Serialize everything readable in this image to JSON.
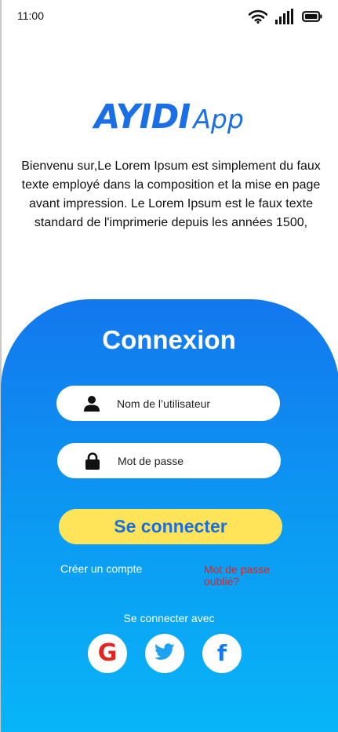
{
  "status_bar": {
    "time": "11:00",
    "icons": [
      "wifi-icon",
      "signal-icon",
      "battery-icon"
    ]
  },
  "logo": {
    "main": "AYIDI",
    "sub": "App",
    "color": "#1a6fe6"
  },
  "intro_text": "Bienvenu sur,Le Lorem Ipsum est simplement du faux texte employé dans la composition et la mise en page avant impression. Le Lorem Ipsum est le faux texte standard de l'imprimerie depuis les années 1500,",
  "login": {
    "title": "Connexion",
    "username_placeholder": "Nom de l’utilisateur",
    "username_value": "",
    "password_placeholder": "Mot de passe",
    "password_value": "",
    "submit_label": "Se connecter",
    "create_account_label": "Créer un compte",
    "forgot_password_label": "Mot de passe oublié?",
    "connect_with_label": "Se connecter avec",
    "social": [
      {
        "name": "google",
        "icon": "google-icon",
        "glyph": "G",
        "color": "#e52521"
      },
      {
        "name": "twitter",
        "icon": "twitter-icon",
        "color": "#1da1f2"
      },
      {
        "name": "facebook",
        "icon": "facebook-icon",
        "glyph": "f",
        "color": "#1877f2"
      }
    ]
  },
  "colors": {
    "panel_top": "#1377ee",
    "panel_bottom": "#08b6f8",
    "button": "#ffe45a",
    "button_text": "#1a6fdc",
    "forgot_link": "#e8201b"
  }
}
